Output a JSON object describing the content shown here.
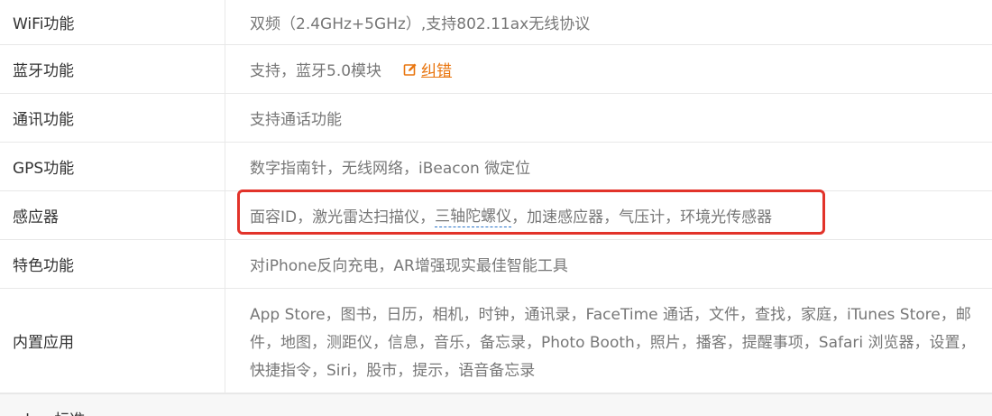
{
  "rows": [
    {
      "label": "WiFi功能",
      "value": "双频（2.4GHz+5GHz）,支持802.11ax无线协议"
    },
    {
      "label": "蓝牙功能",
      "value": "支持，蓝牙5.0模块",
      "action": "纠错"
    },
    {
      "label": "通讯功能",
      "value": "支持通话功能"
    },
    {
      "label": "GPS功能",
      "value": "数字指南针，无线网络，iBeacon 微定位"
    },
    {
      "label": "感应器",
      "value_before": "面容ID，激光雷达扫描仪，",
      "value_term": "三轴陀螺仪",
      "value_after": "，加速感应器，气压计，环境光传感器"
    },
    {
      "label": "特色功能",
      "value": "对iPhone反向充电，AR增强现实最佳智能工具"
    },
    {
      "label": "内置应用",
      "value": "App Store，图书，日历，相机，时钟，通讯录，FaceTime 通话，文件，查找，家庭，iTunes Store，邮件，地图，测距仪，信息，音乐，备忘录，Photo Booth，照片，播客，提醒事项，Safari 浏览器，设置，快捷指令，Siri，股市，提示，语音备忘录"
    }
  ],
  "next_section_label": "<br>标准"
}
